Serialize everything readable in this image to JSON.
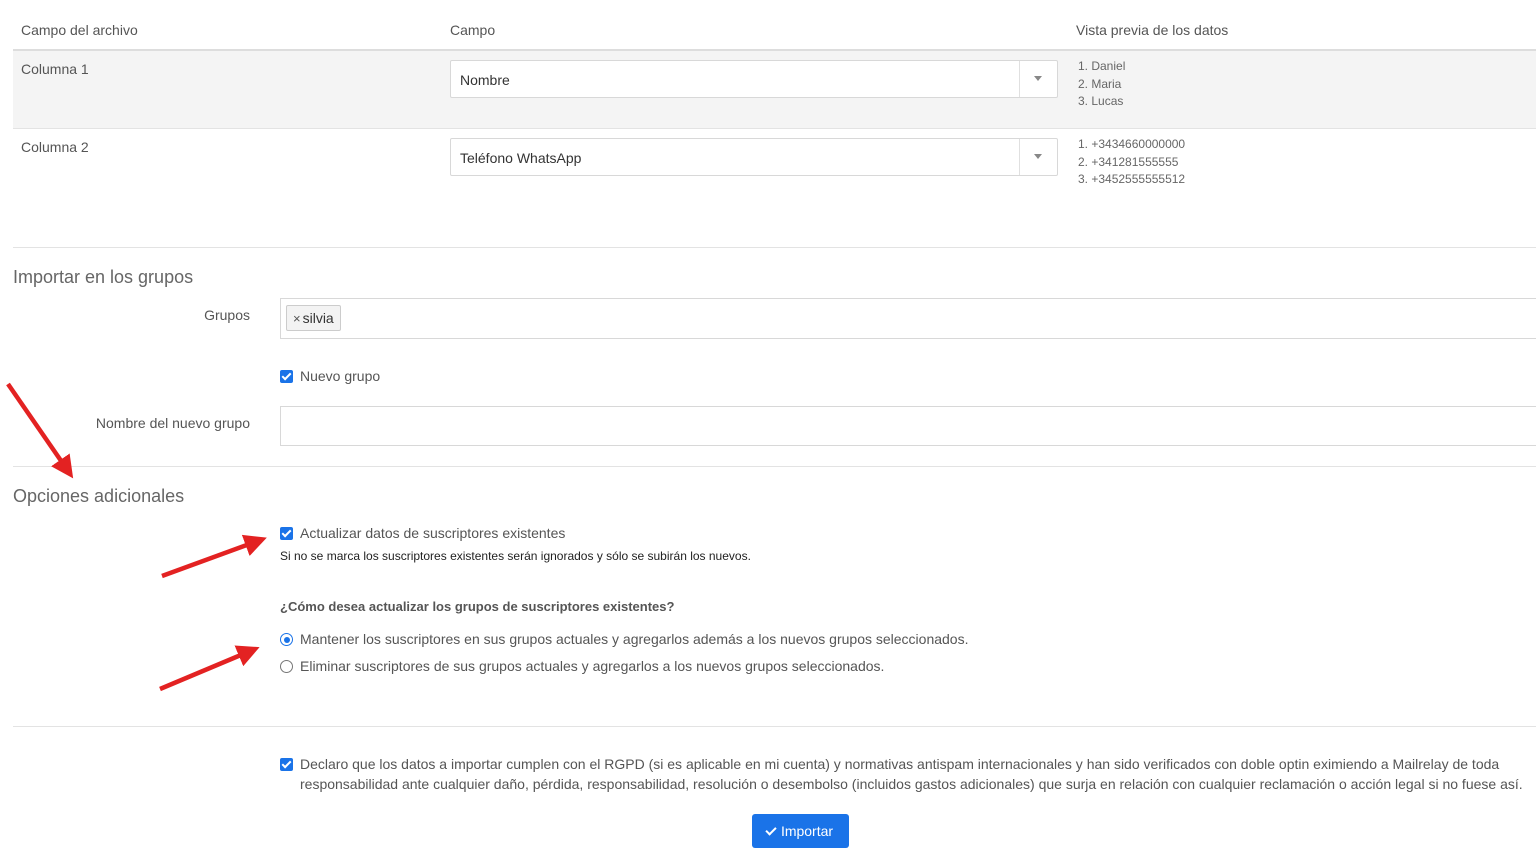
{
  "table": {
    "headers": [
      "Campo del archivo",
      "Campo",
      "Vista previa de los datos"
    ],
    "rows": [
      {
        "label": "Columna 1",
        "field": "Nombre",
        "preview": [
          "1. Daniel",
          "2. Maria",
          "3. Lucas"
        ]
      },
      {
        "label": "Columna 2",
        "field": "Teléfono WhatsApp",
        "preview": [
          "1. +3434660000000",
          "2. +341281555555",
          "3. +3452555555512"
        ]
      }
    ]
  },
  "groups_section": {
    "title": "Importar en los grupos",
    "groups_label": "Grupos",
    "selected_groups": [
      {
        "remove": "×",
        "name": "silvia"
      }
    ],
    "new_group_checkbox": {
      "label": "Nuevo grupo",
      "checked": true
    },
    "new_group_name_label": "Nombre del nuevo grupo",
    "new_group_name_value": ""
  },
  "additional_options": {
    "title": "Opciones adicionales",
    "update_checkbox": {
      "label": "Actualizar datos de suscriptores existentes",
      "checked": true
    },
    "update_help": "Si no se marca los suscriptores existentes serán ignorados y sólo se subirán los nuevos.",
    "groups_question": "¿Cómo desea actualizar los grupos de suscriptores existentes?",
    "radio_options": [
      {
        "label": "Mantener los suscriptores en sus grupos actuales y agregarlos además a los nuevos grupos seleccionados.",
        "selected": true
      },
      {
        "label": "Eliminar suscriptores de sus grupos actuales y agregarlos a los nuevos grupos seleccionados.",
        "selected": false
      }
    ]
  },
  "declaration": {
    "checked": true,
    "text": "Declaro que los datos a importar cumplen con el RGPD (si es aplicable en mi cuenta) y normativas antispam internacionales y han sido verificados con doble optin eximiendo a Mailrelay de toda responsabilidad ante cualquier daño, pérdida, responsabilidad, resolución o desembolso (incluidos gastos adicionales) que surja en relación con cualquier reclamación o acción legal si no fuese así."
  },
  "import_button": {
    "label": "Importar",
    "icon": "check-icon"
  },
  "colors": {
    "accent": "#1a73e8",
    "annotation_arrow": "#e32222",
    "row_alt_bg": "#f4f4f4",
    "border": "#d8d8d8"
  }
}
